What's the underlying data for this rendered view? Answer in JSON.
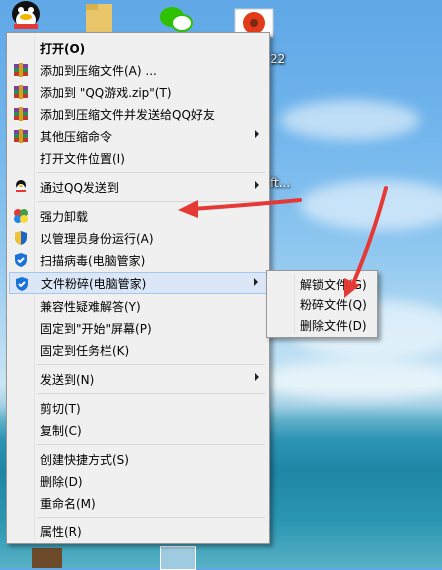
{
  "desktop": {
    "fragments": [
      "22",
      "ft..."
    ]
  },
  "context_menu": {
    "items": [
      {
        "label": "打开(O)",
        "icon": "",
        "bold": true,
        "submenu": false
      },
      {
        "label": "添加到压缩文件(A) ...",
        "icon": "archive-icon",
        "submenu": false
      },
      {
        "label": "添加到 \"QQ游戏.zip\"(T)",
        "icon": "archive-icon",
        "submenu": false
      },
      {
        "label": "添加到压缩文件并发送给QQ好友",
        "icon": "archive-icon",
        "submenu": false
      },
      {
        "label": "其他压缩命令",
        "icon": "archive-icon",
        "submenu": true
      },
      {
        "label": "打开文件位置(I)",
        "icon": "",
        "submenu": false
      },
      {
        "label": "通过QQ发送到",
        "icon": "qq-penguin-icon",
        "submenu": true
      },
      {
        "label": "强力卸载",
        "icon": "uninstall-icon",
        "submenu": false
      },
      {
        "label": "以管理员身份运行(A)",
        "icon": "uac-shield-icon",
        "submenu": false
      },
      {
        "label": "扫描病毒(电脑管家)",
        "icon": "tencent-shield-icon",
        "submenu": false
      },
      {
        "label": "文件粉碎(电脑管家)",
        "icon": "tencent-shield-icon",
        "submenu": true,
        "highlighted": true
      },
      {
        "label": "兼容性疑难解答(Y)",
        "icon": "",
        "submenu": false
      },
      {
        "label": "固定到\"开始\"屏幕(P)",
        "icon": "",
        "submenu": false
      },
      {
        "label": "固定到任务栏(K)",
        "icon": "",
        "submenu": false
      },
      {
        "label": "发送到(N)",
        "icon": "",
        "submenu": true
      },
      {
        "label": "剪切(T)",
        "icon": "",
        "submenu": false
      },
      {
        "label": "复制(C)",
        "icon": "",
        "submenu": false
      },
      {
        "label": "创建快捷方式(S)",
        "icon": "",
        "submenu": false
      },
      {
        "label": "删除(D)",
        "icon": "",
        "submenu": false
      },
      {
        "label": "重命名(M)",
        "icon": "",
        "submenu": false
      },
      {
        "label": "属性(R)",
        "icon": "",
        "submenu": false
      }
    ]
  },
  "submenu": {
    "items": [
      {
        "label": "解锁文件(G)"
      },
      {
        "label": "粉碎文件(Q)"
      },
      {
        "label": "删除文件(D)"
      }
    ]
  },
  "colors": {
    "annotation_arrow": "#e53935",
    "highlight": "#dbe7f7",
    "menu_bg": "#f0f0f0"
  }
}
